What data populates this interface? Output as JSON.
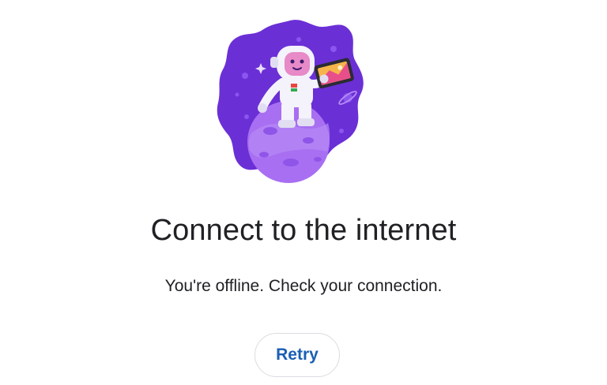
{
  "illustration": {
    "name": "astronaut-on-planet-illustration",
    "colors": {
      "blob": "#6b2fd6",
      "blob_light": "#8b55ef",
      "planet": "#a86ff2",
      "planet_crater": "#8f55e8",
      "suit": "#f4f2fb",
      "face": "#e889c8"
    }
  },
  "main": {
    "title": "Connect to the internet",
    "subtitle": "You're offline. Check your connection.",
    "retry_label": "Retry"
  },
  "colors": {
    "background": "#ffffff",
    "text": "#202124",
    "accent": "#1a5fb4",
    "button_border": "#dadce0"
  }
}
